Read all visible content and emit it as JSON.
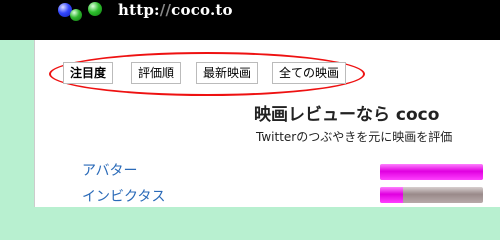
{
  "header": {
    "site_url_prefix": "http:",
    "site_url_sep": "//",
    "site_url_domain": "coco.to"
  },
  "tabs": [
    {
      "label": "注目度",
      "active": true
    },
    {
      "label": "評価順",
      "active": false
    },
    {
      "label": "最新映画",
      "active": false
    },
    {
      "label": "全ての映画",
      "active": false
    }
  ],
  "main": {
    "title": "映画レビューなら coco",
    "subtitle": "Twitterのつぶやきを元に映画を評価"
  },
  "movies": [
    {
      "title": "アバター",
      "rating_fraction": 1.0
    },
    {
      "title": "インビクタス",
      "rating_fraction": 0.22
    }
  ],
  "colors": {
    "accent_pink": "#e000e0",
    "link_blue": "#2a6ab8",
    "highlight_red": "#e11111"
  }
}
